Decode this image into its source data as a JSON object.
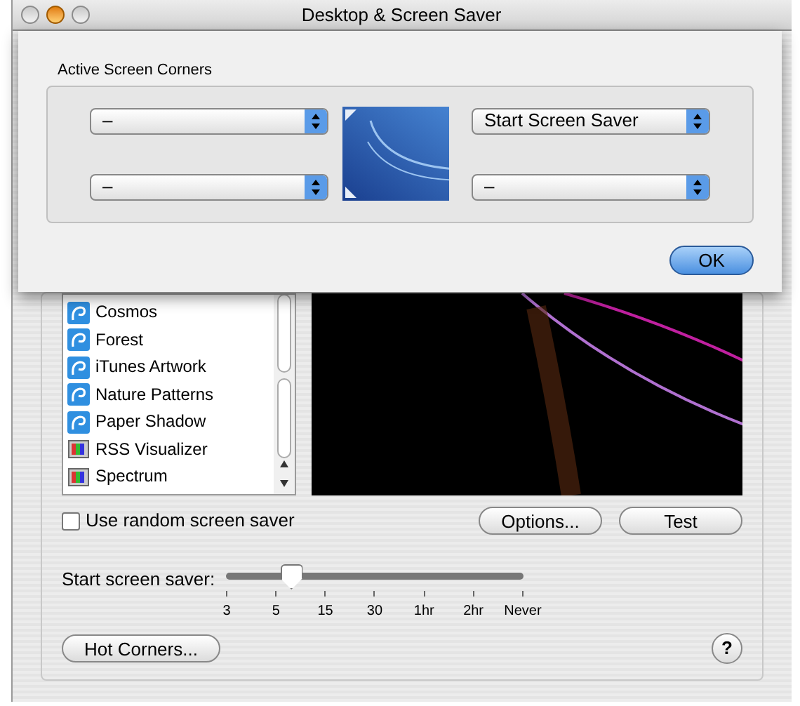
{
  "window": {
    "title": "Desktop & Screen Saver"
  },
  "sheet": {
    "title": "Active Screen Corners",
    "left_popups": [
      {
        "value": "–"
      },
      {
        "value": "–"
      }
    ],
    "right_popups": [
      {
        "value": "Start Screen Saver"
      },
      {
        "value": "–"
      }
    ],
    "ok_button": "OK"
  },
  "screen_savers": [
    {
      "name": "Cosmos",
      "kind": "spiral"
    },
    {
      "name": "Forest",
      "kind": "spiral"
    },
    {
      "name": "iTunes Artwork",
      "kind": "spiral"
    },
    {
      "name": "Nature Patterns",
      "kind": "spiral"
    },
    {
      "name": "Paper Shadow",
      "kind": "spiral"
    },
    {
      "name": "RSS Visualizer",
      "kind": "spectrum"
    },
    {
      "name": "Spectrum",
      "kind": "spectrum"
    }
  ],
  "random_checkbox": {
    "label": "Use random screen saver",
    "checked": false
  },
  "options_button": "Options...",
  "test_button": "Test",
  "slider": {
    "label": "Start screen saver:",
    "level": 0.22,
    "ticks": [
      "3",
      "5",
      "15",
      "30",
      "1hr",
      "2hr",
      "Never"
    ]
  },
  "hot_corners_button": "Hot Corners...",
  "help_button": "?"
}
